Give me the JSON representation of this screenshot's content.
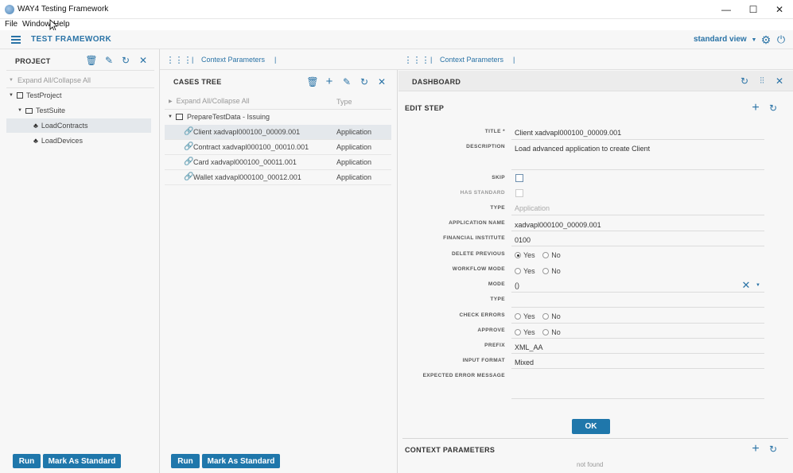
{
  "window": {
    "title": "WAY4 Testing Framework",
    "controls": [
      "—",
      "☐",
      "✕"
    ]
  },
  "menu": [
    "File",
    "Window",
    "Help"
  ],
  "header": {
    "app_title": "TEST FRAMEWORK",
    "view_selector": "standard view"
  },
  "project": {
    "title": "PROJECT",
    "expand_all": "Expand All/Collapse All",
    "tree": [
      {
        "label": "TestProject"
      },
      {
        "label": "TestSuite"
      },
      {
        "label": "LoadContracts"
      },
      {
        "label": "LoadDevices"
      }
    ],
    "run_label": "Run",
    "mark_label": "Mark As Standard"
  },
  "middle": {
    "breadcrumb": "Context Parameters",
    "title": "CASES TREE",
    "expand_all": "Expand All/Collapse All",
    "type_header": "Type",
    "group": "PrepareTestData - Issuing",
    "cases": [
      {
        "label": "Client xadvapl000100_00009.001",
        "type": "Application"
      },
      {
        "label": "Contract xadvapl000100_00010.001",
        "type": "Application"
      },
      {
        "label": "Card xadvapl000100_00011.001",
        "type": "Application"
      },
      {
        "label": "Wallet xadvapl000100_00012.001",
        "type": "Application"
      }
    ],
    "run_label": "Run",
    "mark_label": "Mark As Standard"
  },
  "right": {
    "breadcrumb": "Context Parameters",
    "title": "DASHBOARD",
    "edit_step": {
      "title": "EDIT STEP",
      "labels": {
        "title": "TITLE",
        "description": "DESCRIPTION",
        "skip": "SKIP",
        "has_standard": "HAS STANDARD",
        "type": "TYPE",
        "application_name": "APPLICATION NAME",
        "financial_institute": "FINANCIAL INSTITUTE",
        "delete_previous": "DELETE PREVIOUS",
        "workflow_mode": "WORKFLOW MODE",
        "mode": "MODE",
        "type2": "TYPE",
        "check_errors": "CHECK ERRORS",
        "approve": "APPROVE",
        "prefix": "PREFIX",
        "input_format": "INPUT FORMAT",
        "expected_error": "EXPECTED ERROR MESSAGE"
      },
      "required_mark": "*",
      "values": {
        "title": "Client xadvapl000100_00009.001",
        "description": "Load advanced application to create Client",
        "type": "Application",
        "application_name": "xadvapl000100_00009.001",
        "financial_institute": "0100",
        "mode": "()",
        "prefix": "XML_AA",
        "input_format": "Mixed"
      },
      "yes": "Yes",
      "no": "No",
      "skip_checked": false,
      "has_standard_checked": false,
      "delete_previous": "Yes",
      "ok_label": "OK"
    },
    "context_parameters": {
      "title": "CONTEXT PARAMETERS",
      "empty": "not found"
    }
  },
  "colors": {
    "accent": "#2a73a6",
    "button": "#1f77ab",
    "selected_row": "#e4e8ec"
  }
}
